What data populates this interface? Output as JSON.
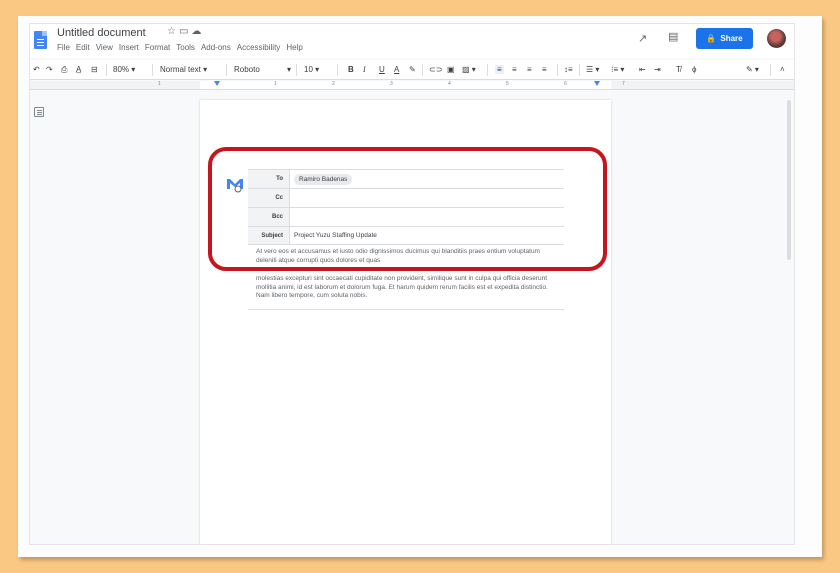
{
  "title": {
    "document_name": "Untitled document",
    "icons": [
      "star-icon",
      "folder-move-icon",
      "cloud-status-icon"
    ]
  },
  "menu": [
    "File",
    "Edit",
    "View",
    "Insert",
    "Format",
    "Tools",
    "Add-ons",
    "Accessibility",
    "Help"
  ],
  "topright": {
    "share_label": "Share",
    "icons": [
      "activity-dashboard-icon",
      "comment-icon",
      "lock-icon",
      "avatar"
    ]
  },
  "toolbar": {
    "zoom": "80%",
    "style": "Normal text",
    "font": "Roboto",
    "size": "10",
    "bold": "B",
    "italic": "I",
    "underline": "U",
    "text_color": "A"
  },
  "ruler": {
    "marks": [
      "1",
      "1",
      "2",
      "3",
      "4",
      "5",
      "6",
      "7"
    ]
  },
  "email": {
    "to_label": "To",
    "to_value": "Ramiro Badenas",
    "cc_label": "Cc",
    "bcc_label": "Bcc",
    "subject_label": "Subject",
    "subject_value": "Project Yuzu Staffing Update",
    "paragraph1": "At vero eos et accusamus et iusto odio dignissimos ducimus qui blanditiis praes entium voluptatum deleniti atque corrupti quos dolores et quas",
    "paragraph2": "molestias excepturi sint occaecati cupiditate non provident, similique sunt in culpa qui officia deserunt mollitia animi, id est laborum et dolorum fuga. Et harum quidem rerum facilis est et expedita distinctio. Nam libero tempore, cum soluta nobis."
  },
  "colors": {
    "background": "#fbc883",
    "share_blue": "#1a73e8",
    "highlight_red": "#c5161d",
    "doc_blue": "#4285f4"
  }
}
